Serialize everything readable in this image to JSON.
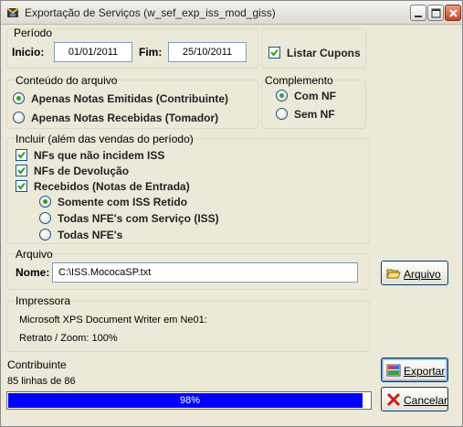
{
  "window": {
    "title": "Exportação de Serviços (w_sef_exp_iss_mod_giss)"
  },
  "periodo": {
    "title": "Período",
    "inicio_label": "Inicio:",
    "inicio_value": "01/01/2011",
    "fim_label": "Fim:",
    "fim_value": "25/10/2011"
  },
  "listar_cupons": {
    "label": "Listar Cupons",
    "checked": true
  },
  "conteudo": {
    "title": "Conteúdo do arquivo",
    "options": [
      {
        "label": "Apenas Notas Emitidas (Contribuinte)",
        "selected": true
      },
      {
        "label": "Apenas Notas Recebidas (Tomador)",
        "selected": false
      }
    ]
  },
  "complemento": {
    "title": "Complemento",
    "options": [
      {
        "label": "Com NF",
        "selected": true
      },
      {
        "label": "Sem NF",
        "selected": false
      }
    ]
  },
  "incluir": {
    "title": "Incluir (além das vendas do período)",
    "checks": [
      {
        "label": "NFs que não incidem ISS",
        "checked": true
      },
      {
        "label": "NFs de Devolução",
        "checked": true
      },
      {
        "label": "Recebidos (Notas de Entrada)",
        "checked": true
      }
    ],
    "recebidos_options": [
      {
        "label": "Somente com ISS Retido",
        "selected": true
      },
      {
        "label": "Todas NFE's com Serviço (ISS)",
        "selected": false
      },
      {
        "label": "Todas NFE's",
        "selected": false
      }
    ]
  },
  "arquivo": {
    "title": "Arquivo",
    "nome_label": "Nome:",
    "nome_value": "C:\\ISS.MococaSP.txt",
    "button_label": "Arquivo"
  },
  "impressora": {
    "title": "Impressora",
    "printer": "Microsoft XPS Document Writer em Ne01:",
    "zoom": "Retrato / Zoom: 100%"
  },
  "status": {
    "title": "Contribuinte",
    "lines": "85 linhas de 86",
    "progress_percent": 98,
    "progress_text": "98%"
  },
  "buttons": {
    "exportar": "Exportar",
    "cancelar": "Cancelar"
  },
  "colors": {
    "progress_fill": "#0000ff",
    "window_bg": "#ece9d8",
    "check_mark": "#21a121",
    "cancel_icon": "#c81e1e"
  },
  "icons": {
    "app": "app-icon",
    "minimize": "minimize-icon",
    "maximize": "maximize-icon",
    "close": "close-icon",
    "folder": "folder-open-icon",
    "export": "export-icon",
    "cancel": "cancel-x-icon"
  }
}
